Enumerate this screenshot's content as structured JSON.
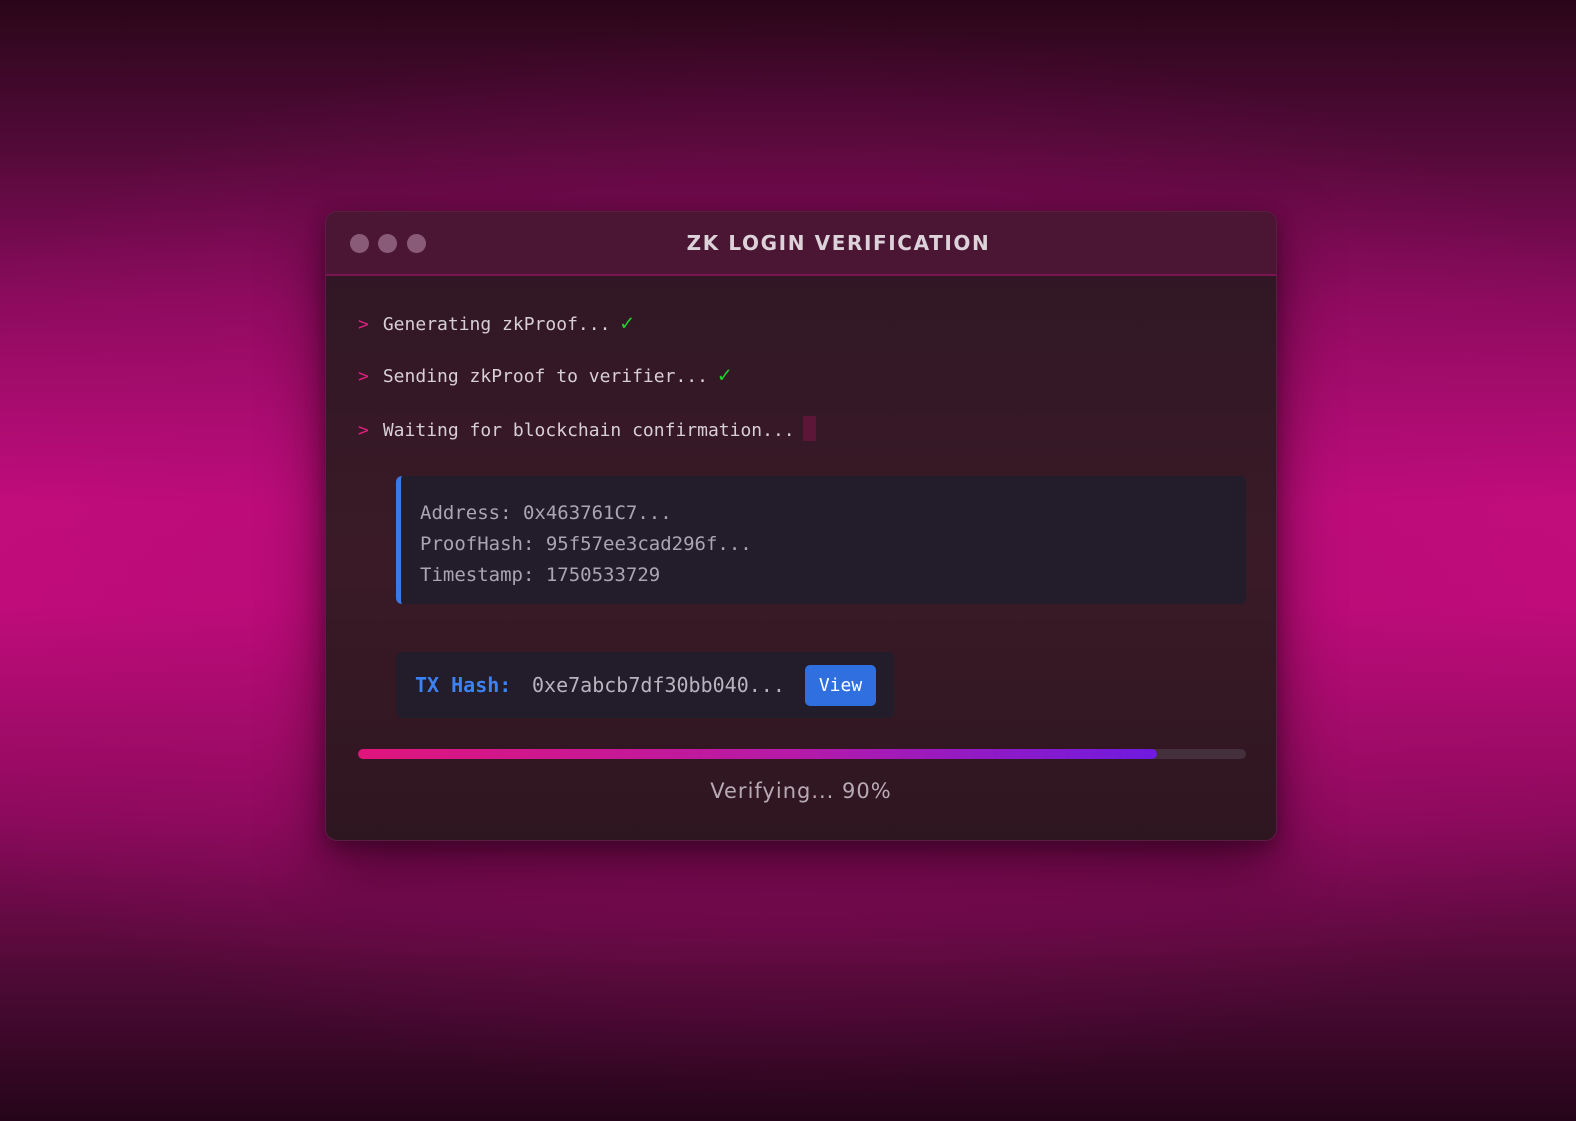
{
  "window": {
    "title": "ZK LOGIN VERIFICATION"
  },
  "log": [
    {
      "prompt": ">",
      "text": "Generating zkProof...",
      "status": "✓"
    },
    {
      "prompt": ">",
      "text": "Sending zkProof to verifier...",
      "status": "✓"
    },
    {
      "prompt": ">",
      "text": "Waiting for blockchain confirmation...",
      "status": ""
    }
  ],
  "details": {
    "address": "Address: 0x463761C7...",
    "proof_hash": "ProofHash: 95f57ee3cad296f...",
    "timestamp": "Timestamp: 1750533729"
  },
  "transaction": {
    "label": "TX Hash:",
    "value": "0xe7abcb7df30bb040...",
    "view_label": "View"
  },
  "progress": {
    "percent": 90,
    "text": "Verifying... 90%"
  },
  "colors": {
    "accent_pink": "#e0207f",
    "success_green": "#19d22a",
    "link_blue": "#3b82f6",
    "button_blue": "#2f6fe0"
  },
  "icons": {
    "window_controls": [
      "window-close-dot-icon",
      "window-minimize-dot-icon",
      "window-maximize-dot-icon"
    ],
    "status": "checkmark-icon",
    "cursor": "terminal-cursor-icon"
  }
}
